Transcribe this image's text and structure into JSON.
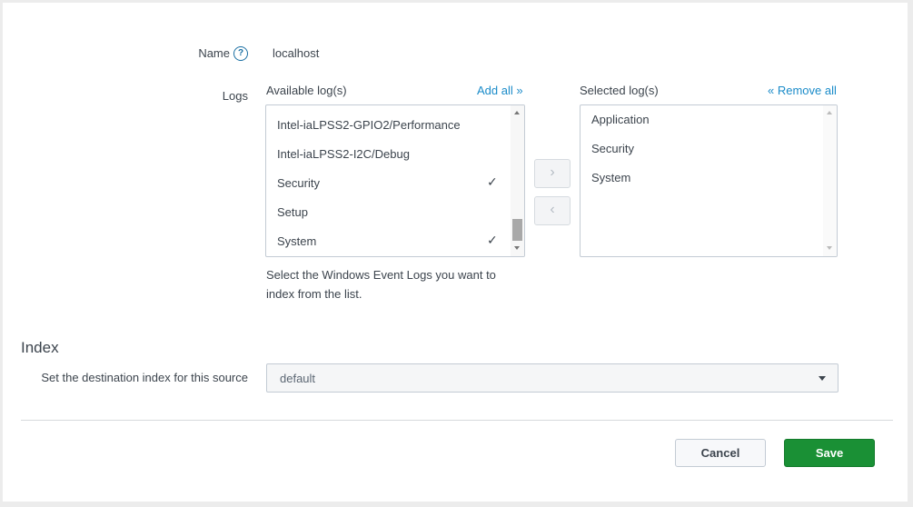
{
  "name": {
    "label": "Name",
    "help_icon": "question-icon",
    "value": "localhost"
  },
  "logs": {
    "label": "Logs",
    "available": {
      "header": "Available log(s)",
      "add_all": "Add all »",
      "items": [
        {
          "label": "Intel-iaLPSS2-GPIO2/Performance",
          "selected": false
        },
        {
          "label": "Intel-iaLPSS2-I2C/Debug",
          "selected": false
        },
        {
          "label": "Security",
          "selected": true
        },
        {
          "label": "Setup",
          "selected": false
        },
        {
          "label": "System",
          "selected": true
        }
      ],
      "check_glyph": "✓"
    },
    "selected": {
      "header": "Selected log(s)",
      "remove_all": "« Remove all",
      "items": [
        "Application",
        "Security",
        "System"
      ]
    },
    "move_right": "›",
    "move_left": "‹",
    "help_line1": "Select the Windows Event Logs you want to",
    "help_line2": "index from the list."
  },
  "index": {
    "section_title": "Index",
    "label": "Set the destination index for this source",
    "value": "default"
  },
  "actions": {
    "cancel": "Cancel",
    "save": "Save"
  },
  "colors": {
    "link": "#1a8bc9",
    "save": "#1a9035",
    "help_icon": "#1a6fa3"
  }
}
